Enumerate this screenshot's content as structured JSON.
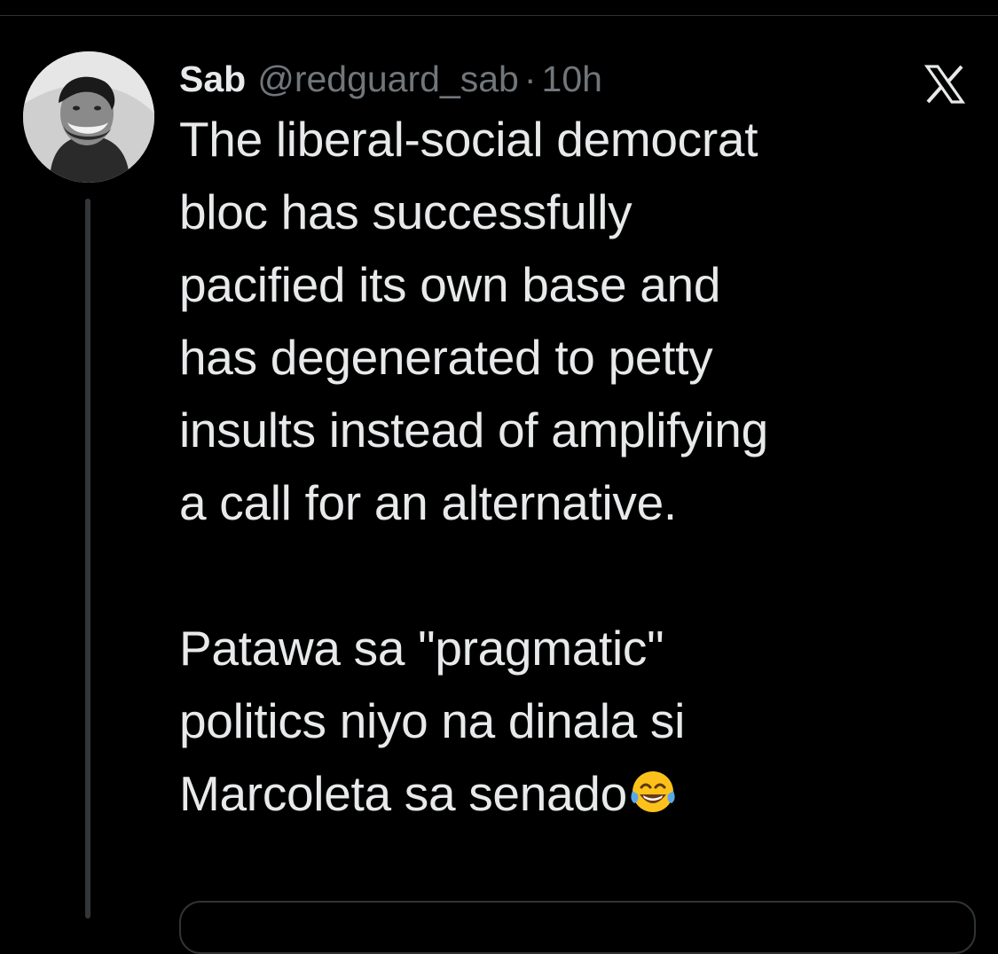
{
  "tweet": {
    "author_name": "Sab",
    "author_handle": "@redguard_sab",
    "separator": "·",
    "time": "10h",
    "avatar_icon": "avatar-photo-icon",
    "brand_icon": "x-logo-icon",
    "body_paragraph_1": [
      "The liberal-social democrat",
      "bloc has successfully",
      "pacified its own base and",
      "has degenerated to petty",
      "insults instead of amplifying",
      "a call for an alternative."
    ],
    "body_paragraph_2": [
      "Patawa sa \"pragmatic\"",
      "politics niyo na dinala si",
      "Marcoleta sa senado"
    ],
    "trailing_emoji": "face-with-tears-of-joy-icon"
  },
  "colors": {
    "background": "#000000",
    "primary_text": "#e7e9ea",
    "secondary_text": "#71767b",
    "divider": "#2f3336"
  }
}
